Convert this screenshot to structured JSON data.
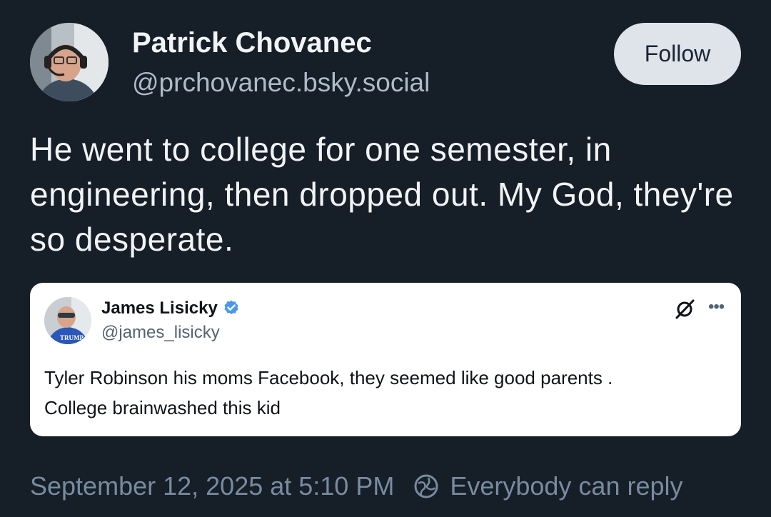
{
  "post": {
    "author": {
      "name": "Patrick Chovanec",
      "handle": "@prchovanec.bsky.social"
    },
    "follow_label": "Follow",
    "text": "He went to college for one semester, in engineering, then dropped out. My God, they're so desperate.",
    "quote": {
      "name": "James Lisicky",
      "handle": "@james_lisicky",
      "avatar_badge": "TRUMP",
      "text_line1": "Tyler Robinson his moms Facebook, they seemed like good parents .",
      "text_line2": "College brainwashed this kid"
    },
    "timestamp": "September 12, 2025 at 5:10 PM",
    "reply_setting": "Everybody can reply"
  },
  "colors": {
    "background": "#161e27",
    "text_primary": "#f1f3f5",
    "text_secondary": "#aebbc9",
    "footer_text": "#788ba0",
    "follow_bg": "#dfe3ea",
    "verified_badge": "#4a99e9"
  },
  "icons": {
    "verified": "verified-badge-icon",
    "grok": "grok-icon",
    "more": "more-options-icon",
    "reply": "reply-permissions-icon"
  }
}
